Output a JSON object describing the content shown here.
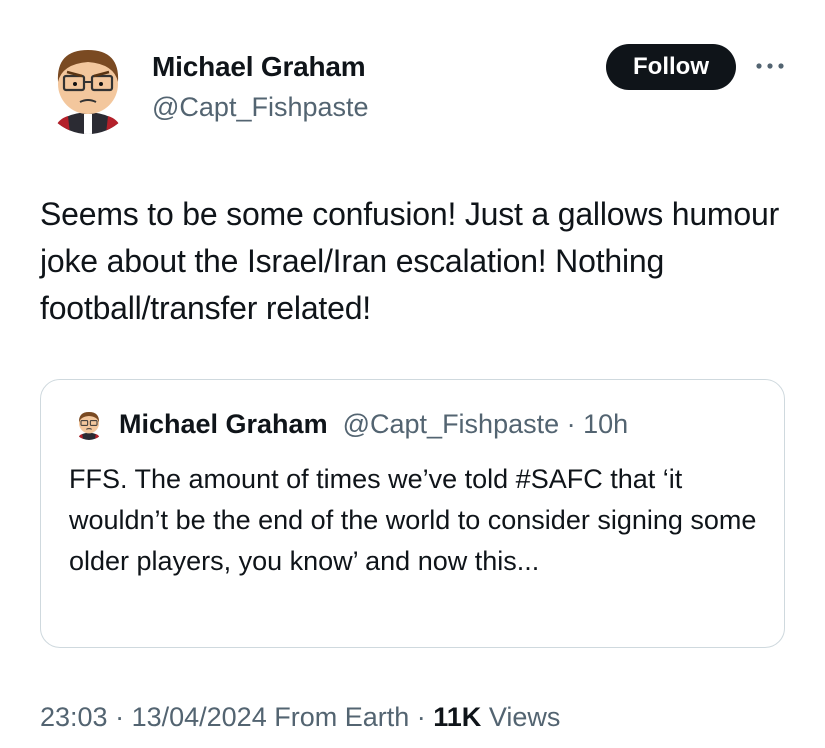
{
  "author": {
    "name": "Michael Graham",
    "handle": "@Capt_Fishpaste",
    "avatar_icon": "cartoon-avatar-icon"
  },
  "actions": {
    "follow_label": "Follow",
    "more_icon": "more-dots-icon"
  },
  "tweet": {
    "text": "Seems to be some confusion! Just a gallows humour joke about the Israel/Iran escalation! Nothing football/transfer related!"
  },
  "quoted_tweet": {
    "name": "Michael Graham",
    "handle": "@Capt_Fishpaste",
    "separator": " · ",
    "age": "10h",
    "text": "FFS. The amount of times we’ve told #SAFC that ‘it wouldn’t be the end of the world to consider signing some older players, you know’ and now this..."
  },
  "footer": {
    "time": "23:03",
    "date": "13/04/2024",
    "location": "From Earth",
    "views_count": "11K",
    "views_label": "Views",
    "separator": " · "
  },
  "colors": {
    "text_primary": "#0f1419",
    "text_secondary": "#536471",
    "border": "#cfd9de",
    "button_bg": "#0f1419"
  }
}
